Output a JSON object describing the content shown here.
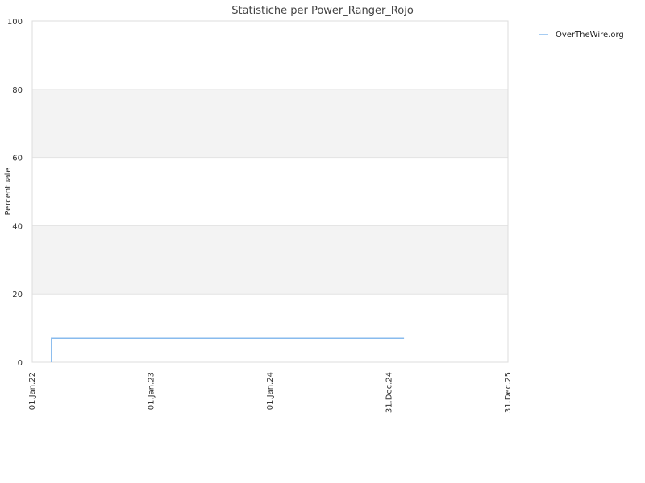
{
  "chart_data": {
    "type": "line",
    "title": "Statistiche per Power_Ranger_Rojo",
    "xlabel": "",
    "ylabel": "Percentuale",
    "ylim": [
      0,
      100
    ],
    "yticks": [
      0,
      20,
      40,
      60,
      80,
      100
    ],
    "x_axis_type": "date",
    "xlim": [
      "2022-01-01",
      "2025-12-31"
    ],
    "xticks": [
      {
        "date": "2022-01-01",
        "label": "01.Jan.22"
      },
      {
        "date": "2023-01-01",
        "label": "01.Jan.23"
      },
      {
        "date": "2024-01-01",
        "label": "01.Jan.24"
      },
      {
        "date": "2024-12-31",
        "label": "31.Dec.24"
      },
      {
        "date": "2025-12-31",
        "label": "31.Dec.25"
      }
    ],
    "grid": "alternating horizontal bands",
    "legend_position": "top-right",
    "series": [
      {
        "name": "OverTheWire.org",
        "color": "#88bbee",
        "points": [
          {
            "x": "2022-03-01",
            "y": 0
          },
          {
            "x": "2022-03-01",
            "y": 7
          },
          {
            "x": "2025-02-15",
            "y": 7
          }
        ]
      }
    ]
  }
}
